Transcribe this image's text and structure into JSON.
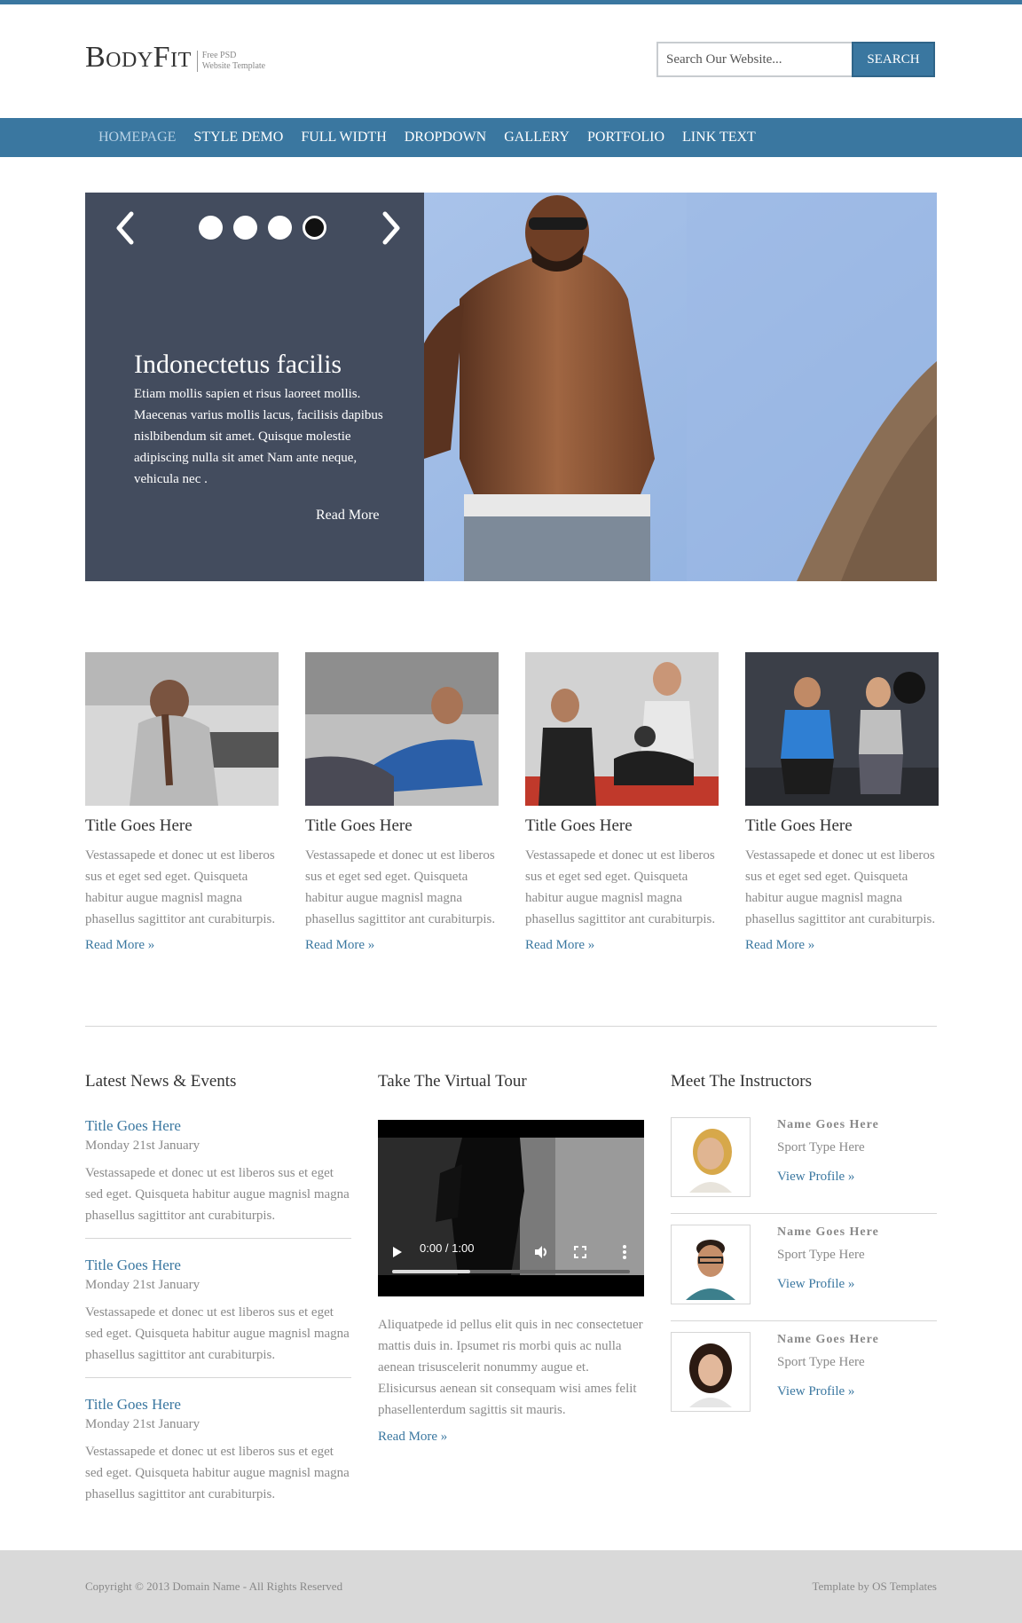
{
  "brand": {
    "name": "BodyFit",
    "tagline_line1": "Free PSD",
    "tagline_line2": "Website Template"
  },
  "search": {
    "placeholder": "Search Our Website...",
    "button_label": "SEARCH"
  },
  "nav": {
    "items": [
      {
        "label": "HOMEPAGE",
        "active": true
      },
      {
        "label": "STYLE DEMO"
      },
      {
        "label": "FULL WIDTH"
      },
      {
        "label": "DROPDOWN"
      },
      {
        "label": "GALLERY"
      },
      {
        "label": "PORTFOLIO"
      },
      {
        "label": "LINK TEXT"
      }
    ]
  },
  "slider": {
    "title": "Indonectetus facilis",
    "text": "Etiam mollis sapien et risus laoreet mollis. Maecenas varius mollis lacus, facilisis dapibus nislbibendum sit amet. Quisque molestie adipiscing nulla sit amet Nam ante neque, vehicula nec .",
    "read_more": "Read More",
    "slide_count": 4,
    "active_slide": 4,
    "prev_icon": "chevron-left-icon",
    "next_icon": "chevron-right-icon"
  },
  "features": [
    {
      "title": "Title Goes Here",
      "text": "Vestassapede et donec ut est liberos sus et eget sed eget. Quisqueta habitur augue magnisl magna phasellus sagittitor ant curabiturpis.",
      "link": "Read More »"
    },
    {
      "title": "Title Goes Here",
      "text": "Vestassapede et donec ut est liberos sus et eget sed eget. Quisqueta habitur augue magnisl magna phasellus sagittitor ant curabiturpis.",
      "link": "Read More »"
    },
    {
      "title": "Title Goes Here",
      "text": "Vestassapede et donec ut est liberos sus et eget sed eget. Quisqueta habitur augue magnisl magna phasellus sagittitor ant curabiturpis.",
      "link": "Read More »"
    },
    {
      "title": "Title Goes Here",
      "text": "Vestassapede et donec ut est liberos sus et eget sed eget. Quisqueta habitur augue magnisl magna phasellus sagittitor ant curabiturpis.",
      "link": "Read More »"
    }
  ],
  "news": {
    "heading": "Latest News & Events",
    "items": [
      {
        "title": "Title Goes Here",
        "date": "Monday 21st January",
        "text": "Vestassapede et donec ut est liberos sus et eget sed eget. Quisqueta habitur augue magnisl magna phasellus sagittitor ant curabiturpis."
      },
      {
        "title": "Title Goes Here",
        "date": "Monday 21st January",
        "text": "Vestassapede et donec ut est liberos sus et eget sed eget. Quisqueta habitur augue magnisl magna phasellus sagittitor ant curabiturpis."
      },
      {
        "title": "Title Goes Here",
        "date": "Monday 21st January",
        "text": "Vestassapede et donec ut est liberos sus et eget sed eget. Quisqueta habitur augue magnisl magna phasellus sagittitor ant curabiturpis."
      }
    ]
  },
  "tour": {
    "heading": "Take The Virtual Tour",
    "video_time": "0:00 / 1:00",
    "video_progress": 0.33,
    "text": "Aliquatpede id pellus elit quis in nec consectetuer mattis duis in. Ipsumet ris morbi quis ac nulla aenean trisuscelerit nonummy augue et. Elisicursus aenean sit consequam wisi ames felit phasellenterdum sagittis sit mauris.",
    "link": "Read More »"
  },
  "instructors": {
    "heading": "Meet The Instructors",
    "items": [
      {
        "name": "Name Goes Here",
        "sport": "Sport Type Here",
        "link": "View Profile »"
      },
      {
        "name": "Name Goes Here",
        "sport": "Sport Type Here",
        "link": "View Profile »"
      },
      {
        "name": "Name Goes Here",
        "sport": "Sport Type Here",
        "link": "View Profile »"
      }
    ]
  },
  "footer": {
    "copyright": "Copyright © 2013 Domain Name - All Rights Reserved",
    "credit": "Template by OS Templates"
  },
  "colors": {
    "accent": "#3a77a0",
    "slider_panel": "#434c5e",
    "muted_text": "#8a8a8a",
    "footer_bg": "#d9d9d9"
  }
}
